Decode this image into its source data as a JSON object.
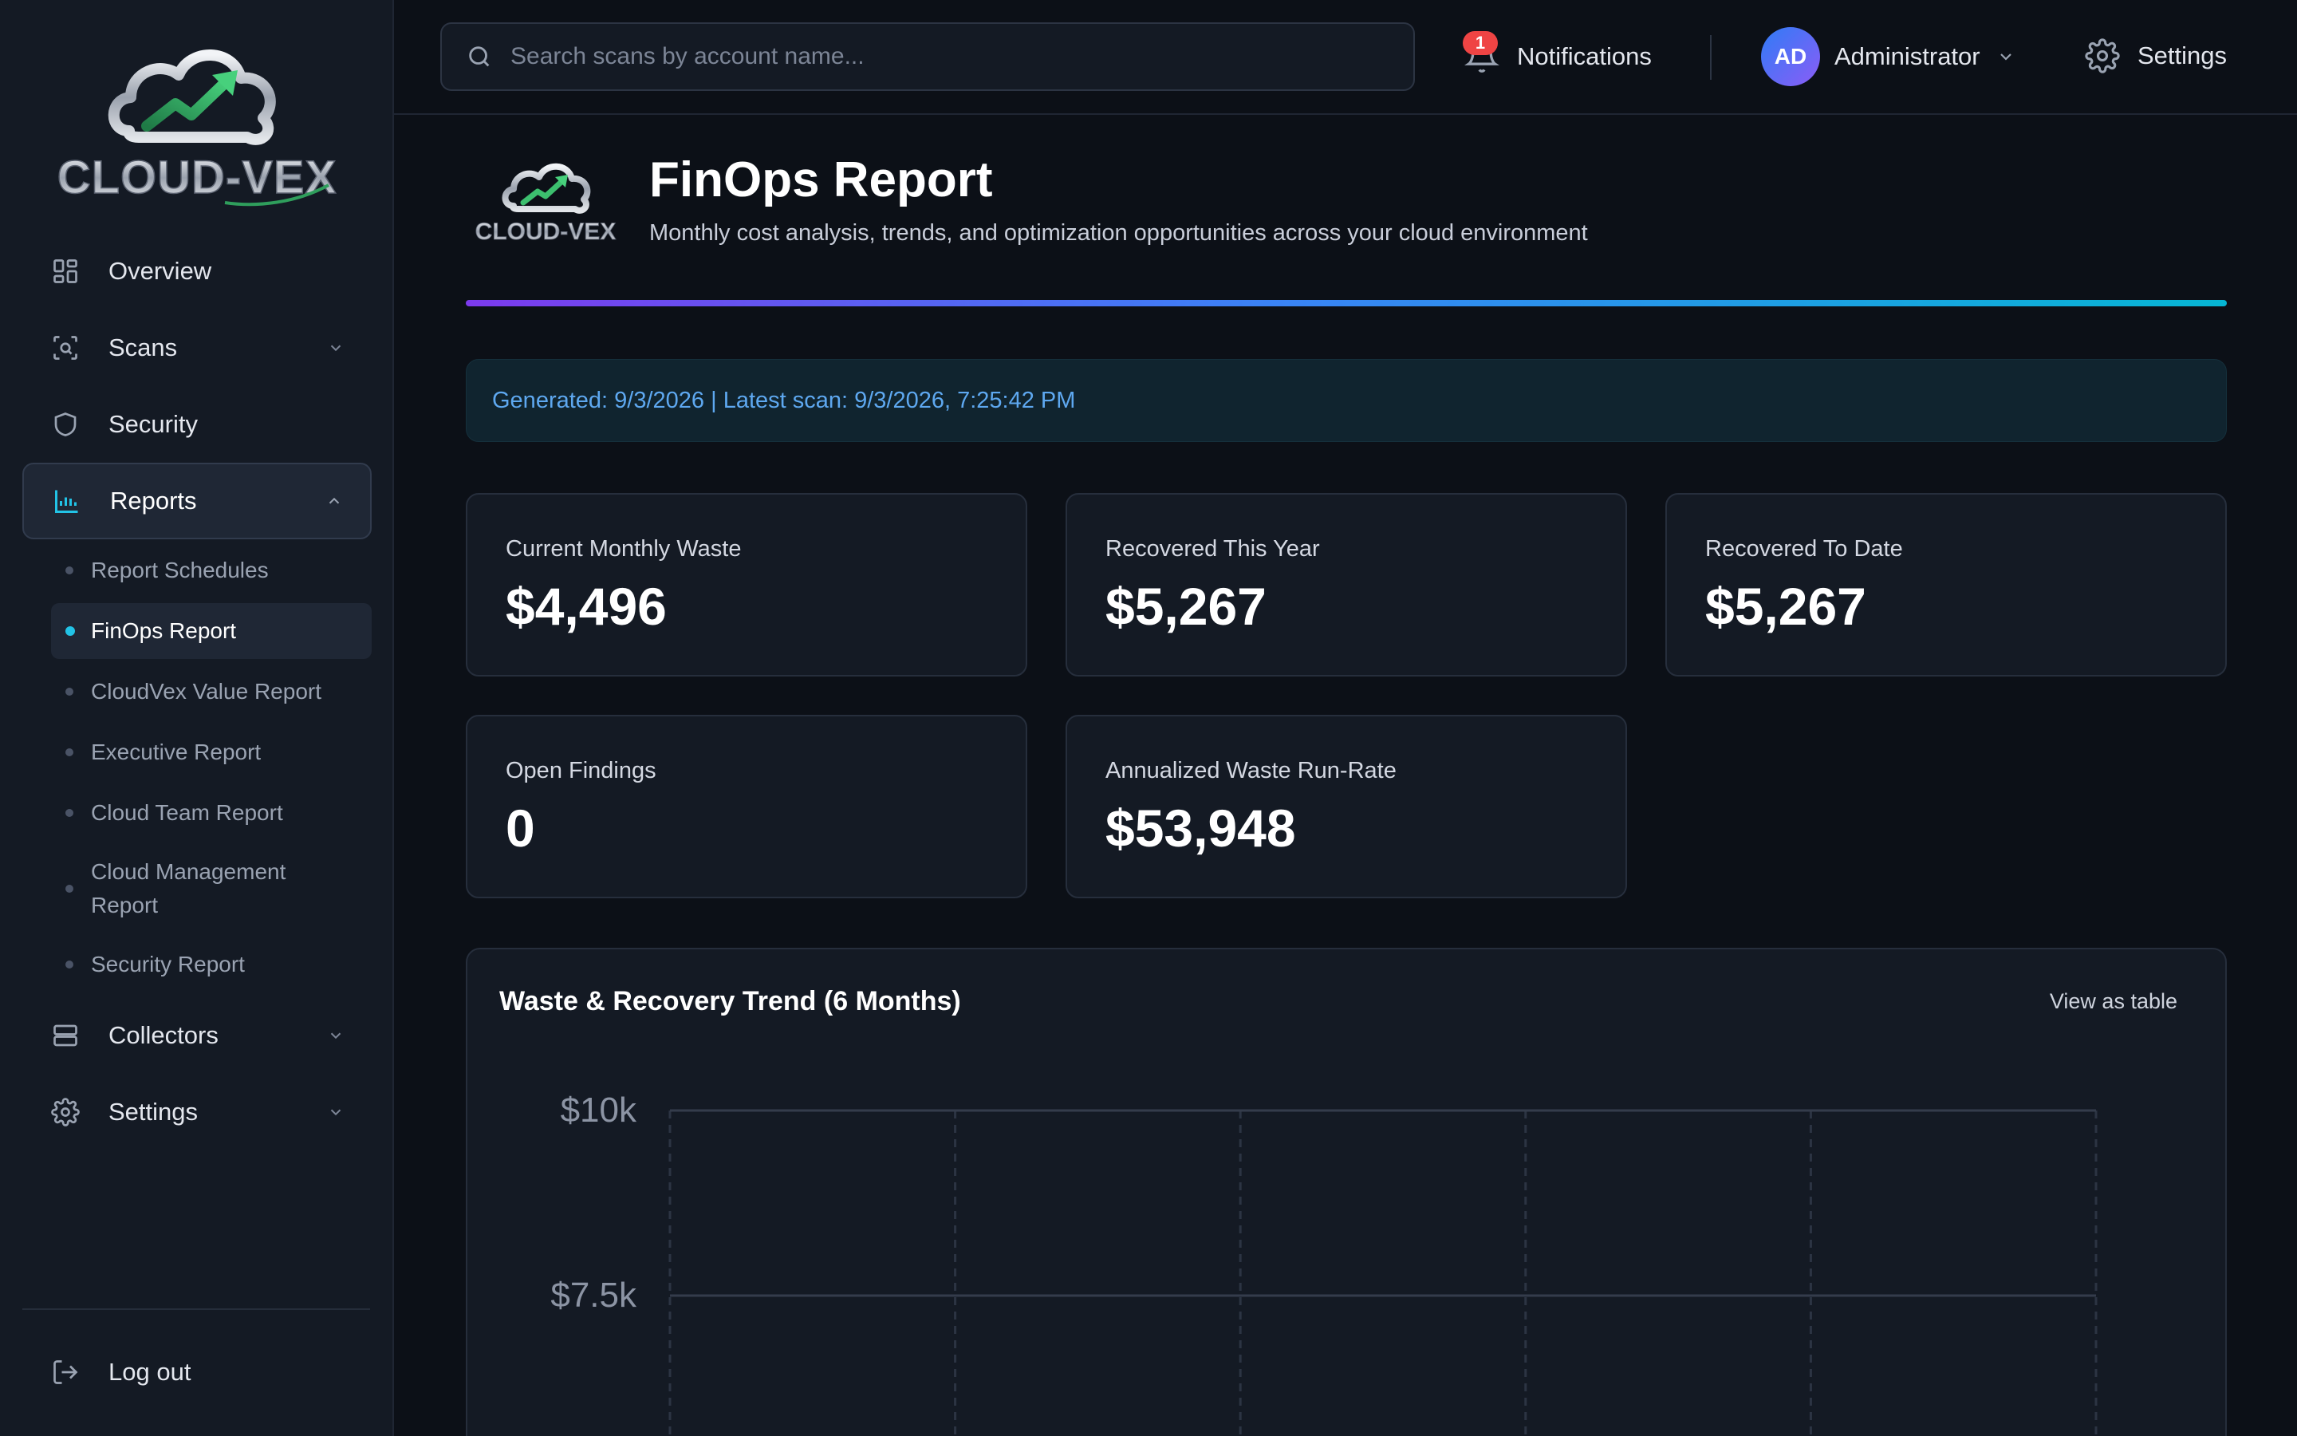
{
  "brand": {
    "name": "CLOUD-VEX"
  },
  "sidebar": {
    "items": [
      {
        "label": "Overview",
        "icon": "grid-icon"
      },
      {
        "label": "Scans",
        "icon": "scan-icon",
        "expandable": true
      },
      {
        "label": "Security",
        "icon": "shield-icon"
      },
      {
        "label": "Reports",
        "icon": "bar-chart-icon",
        "expanded": true,
        "active": true
      },
      {
        "label": "Collectors",
        "icon": "server-icon",
        "expandable": true
      },
      {
        "label": "Settings",
        "icon": "gear-icon",
        "expandable": true
      }
    ],
    "report_items": [
      {
        "label": "Report Schedules"
      },
      {
        "label": "FinOps Report",
        "active": true
      },
      {
        "label": "CloudVex Value Report"
      },
      {
        "label": "Executive Report"
      },
      {
        "label": "Cloud Team Report"
      },
      {
        "label": "Cloud Management Report"
      },
      {
        "label": "Security Report"
      }
    ],
    "logout_label": "Log out"
  },
  "topbar": {
    "search_placeholder": "Search scans by account name...",
    "notifications_label": "Notifications",
    "notifications_count": "1",
    "user_initials": "AD",
    "user_name": "Administrator",
    "settings_label": "Settings"
  },
  "page": {
    "title": "FinOps Report",
    "subtitle": "Monthly cost analysis, trends, and optimization opportunities across your cloud environment",
    "info": "Generated: 9/3/2026 | Latest scan: 9/3/2026, 7:25:42 PM"
  },
  "metrics": [
    {
      "label": "Current Monthly Waste",
      "value": "$4,496"
    },
    {
      "label": "Recovered This Year",
      "value": "$5,267"
    },
    {
      "label": "Recovered To Date",
      "value": "$5,267"
    },
    {
      "label": "Open Findings",
      "value": "0"
    },
    {
      "label": "Annualized Waste Run-Rate",
      "value": "$53,948"
    }
  ],
  "chart": {
    "title": "Waste & Recovery Trend (6 Months)",
    "view_table_label": "View as table"
  },
  "chart_data": {
    "type": "line",
    "title": "Waste & Recovery Trend (6 Months)",
    "y_ticks": [
      "$10k",
      "$7.5k"
    ],
    "ylim": [
      0,
      10000
    ],
    "grid": true,
    "series": []
  },
  "colors": {
    "accent": "#22c3e6",
    "gradient_start": "#7c3aed",
    "gradient_end": "#06b6d4",
    "badge": "#ef4444",
    "info_text": "#5ea8f0"
  }
}
